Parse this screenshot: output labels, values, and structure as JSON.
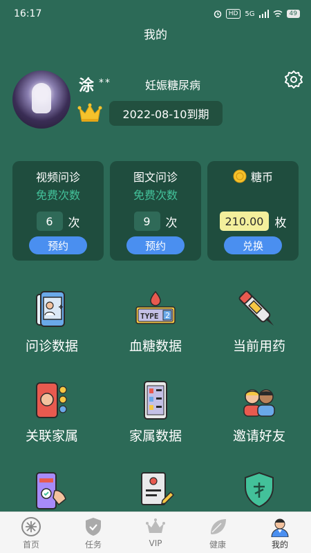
{
  "status": {
    "time": "16:17",
    "network": "5G",
    "hd": "HD",
    "battery": "49"
  },
  "page_title": "我的",
  "profile": {
    "name": "涂",
    "name_mask": "**",
    "condition": "妊娠糖尿病",
    "vip_expire": "2022-08-10到期"
  },
  "cards": {
    "video": {
      "title": "视频问诊",
      "subtitle": "免费次数",
      "count": "6",
      "unit": "次",
      "button": "预约"
    },
    "text": {
      "title": "图文问诊",
      "subtitle": "免费次数",
      "count": "9",
      "unit": "次",
      "button": "预约"
    },
    "coins": {
      "title": "糖币",
      "count": "210.00",
      "unit": "枚",
      "button": "兑换"
    }
  },
  "grid": [
    {
      "label": "问诊数据",
      "icon": "consult-data-icon"
    },
    {
      "label": "血糖数据",
      "icon": "blood-sugar-icon",
      "badge_text": "TYPE",
      "badge_num": "2"
    },
    {
      "label": "当前用药",
      "icon": "insulin-pen-icon"
    },
    {
      "label": "关联家属",
      "icon": "family-link-icon"
    },
    {
      "label": "家属数据",
      "icon": "family-data-icon"
    },
    {
      "label": "邀请好友",
      "icon": "invite-friends-icon"
    },
    {
      "label": "",
      "icon": "phone-tap-icon"
    },
    {
      "label": "",
      "icon": "resume-icon"
    },
    {
      "label": "",
      "icon": "shield-icon"
    }
  ],
  "nav": [
    {
      "label": "首页",
      "icon": "home-icon"
    },
    {
      "label": "任务",
      "icon": "task-icon"
    },
    {
      "label": "VIP",
      "icon": "vip-crown-icon"
    },
    {
      "label": "健康",
      "icon": "leaf-icon"
    },
    {
      "label": "我的",
      "icon": "doctor-avatar-icon"
    }
  ],
  "colors": {
    "background": "#2c6a57",
    "card": "#1f4d3e",
    "accent_green": "#43c19a",
    "button_blue": "#4a8ff0"
  }
}
